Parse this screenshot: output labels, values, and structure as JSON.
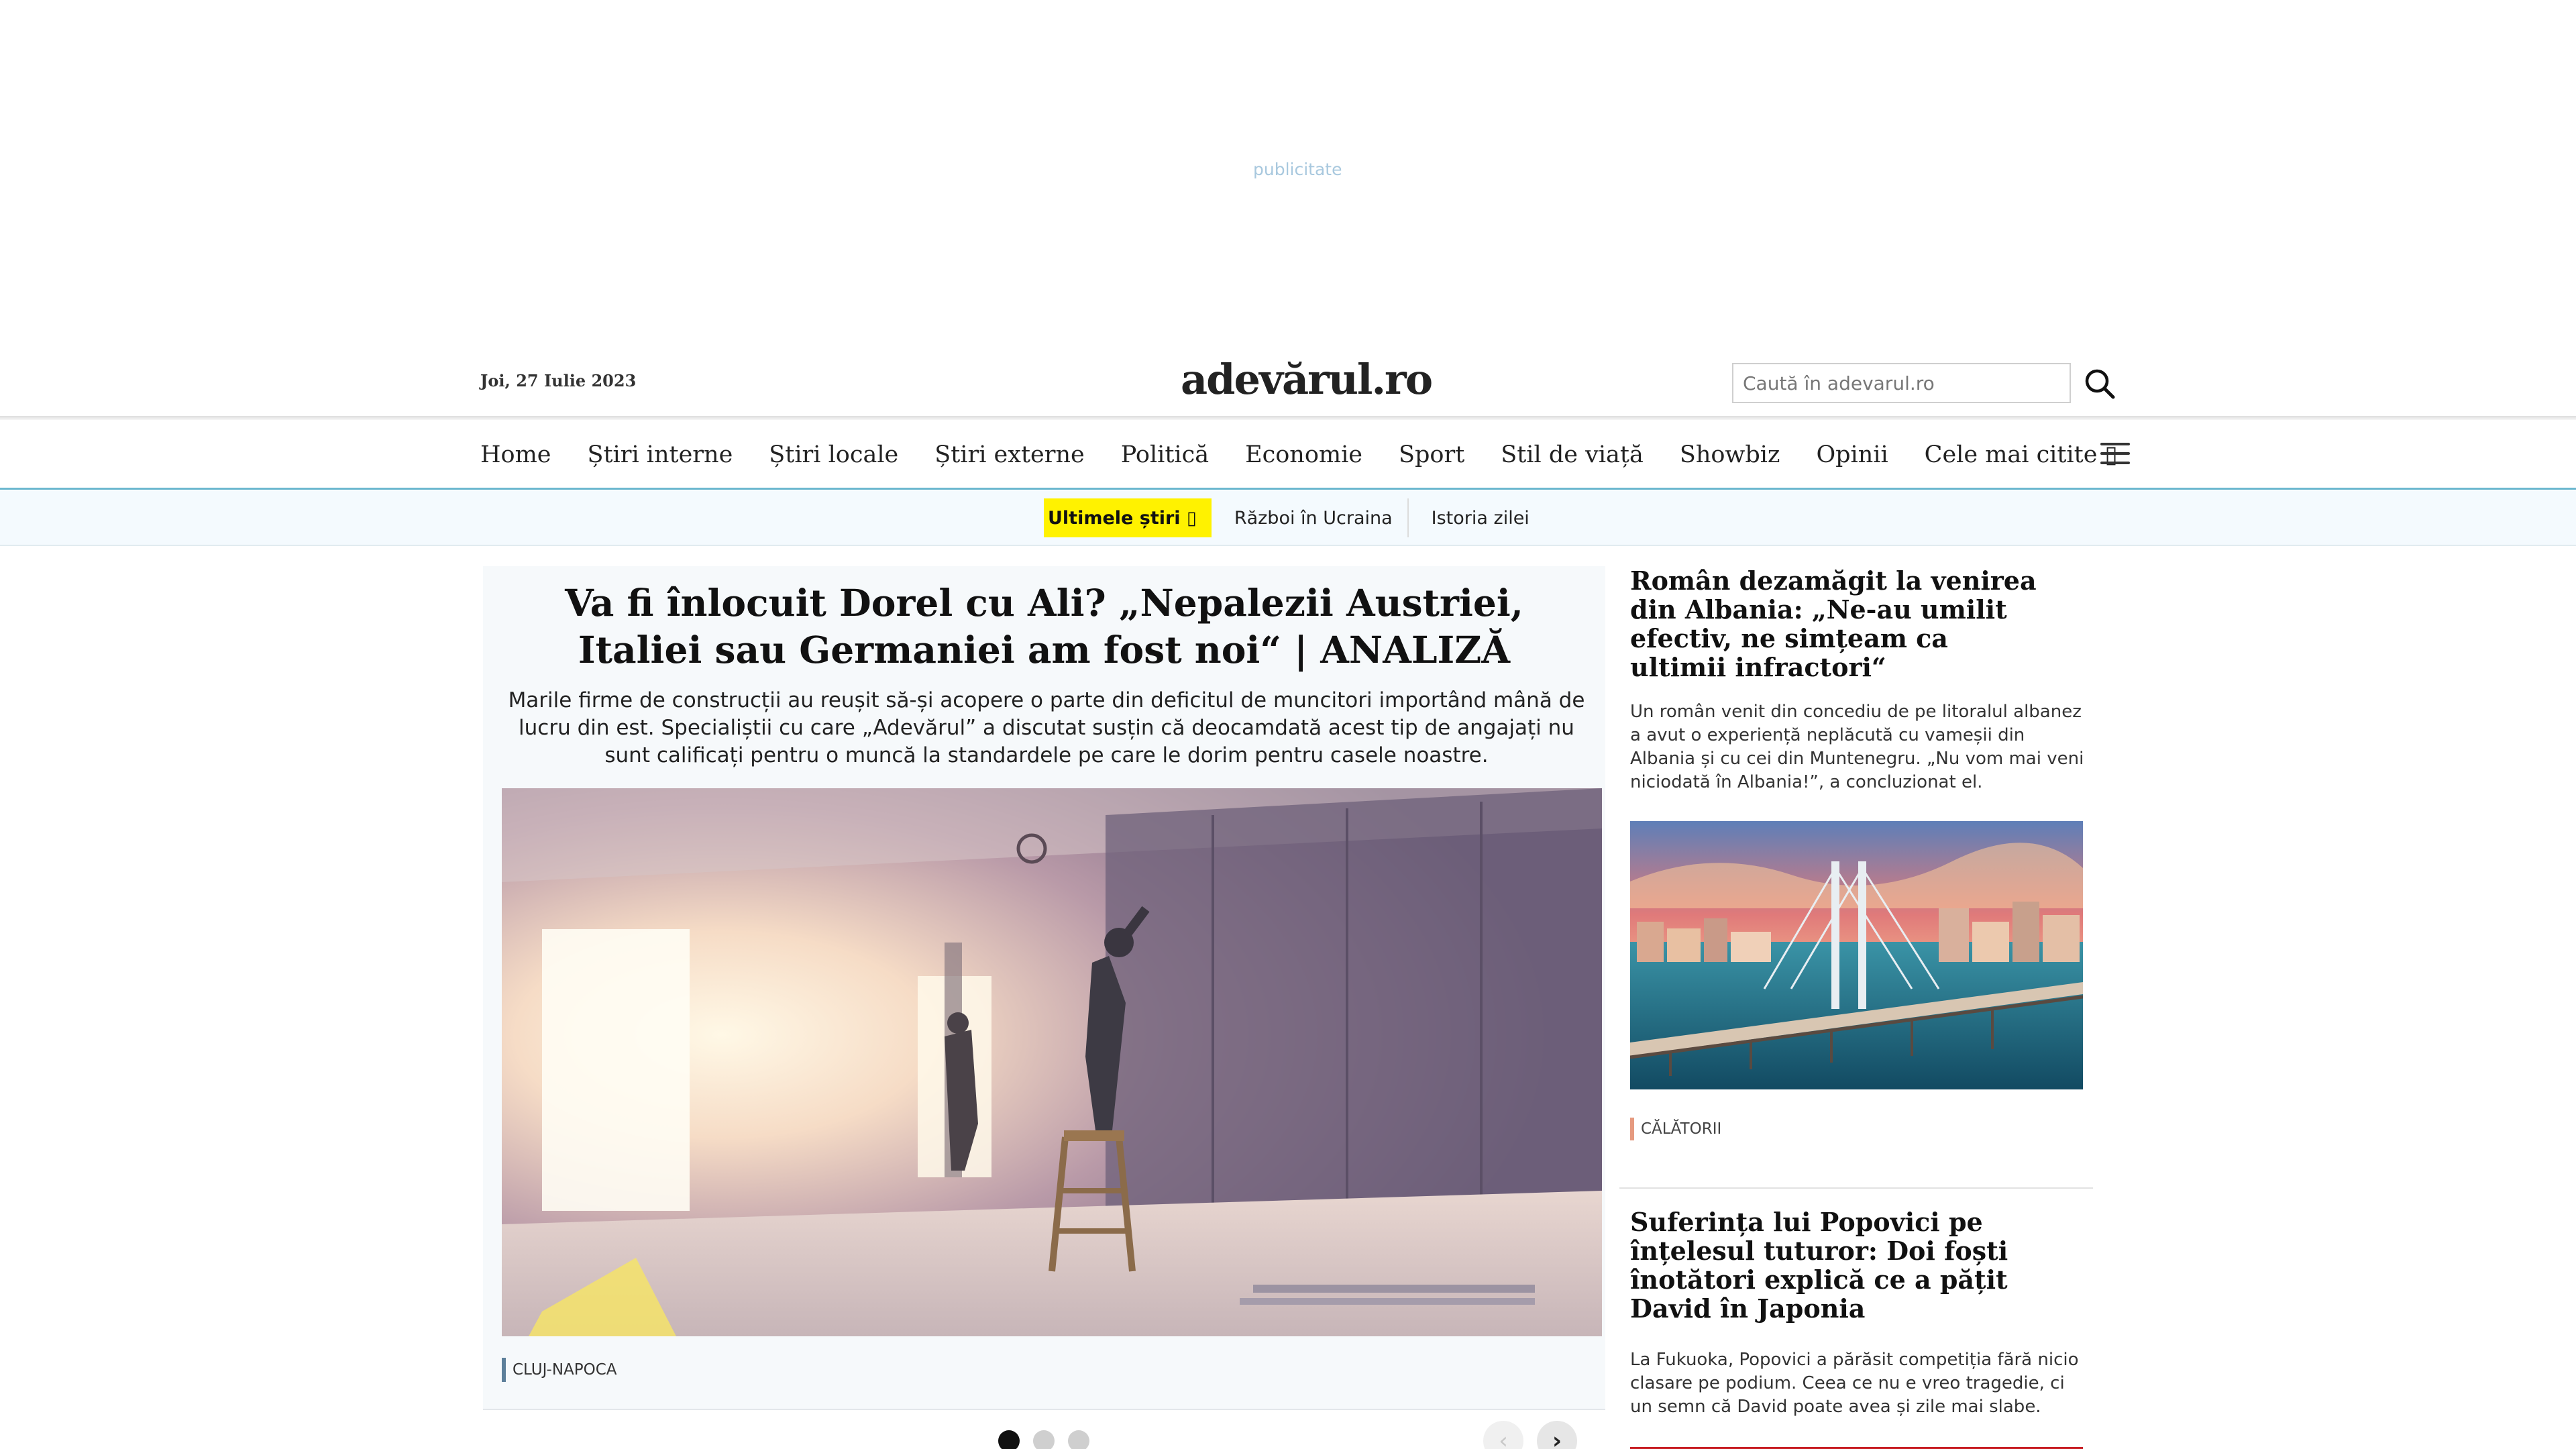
{
  "ad": {
    "label": "publicitate"
  },
  "header": {
    "date": "Joi, 27 Iulie 2023",
    "logo": "adevărul.ro",
    "search_placeholder": "Caută în adevarul.ro"
  },
  "nav": {
    "items": [
      {
        "label": "Home"
      },
      {
        "label": "Știri interne"
      },
      {
        "label": "Știri locale"
      },
      {
        "label": "Știri externe"
      },
      {
        "label": "Politică"
      },
      {
        "label": "Economie"
      },
      {
        "label": "Sport"
      },
      {
        "label": "Stil de viață"
      },
      {
        "label": "Showbiz"
      },
      {
        "label": "Opinii"
      },
      {
        "label": "Cele mai citite ▯"
      }
    ]
  },
  "subnav": {
    "hot": "Ultimele știri ▯",
    "items": [
      {
        "label": "Război în Ucraina"
      },
      {
        "label": "Istoria zilei"
      }
    ]
  },
  "main_article": {
    "title": "Va fi înlocuit Dorel cu Ali? „Nepalezii Austriei, Italiei sau Germaniei am fost noi“ | ANALIZĂ",
    "lead": "Marile firme de construcții au reușit să-și acopere o parte din deficitul de muncitori importând mână de lucru din est. Specialiștii cu care „Adevărul” a discutat susțin că deocamdată acest tip de angajați nu sunt calificați pentru o muncă la standardele pe care le dorim pentru casele noastre.",
    "tag": "CLUJ-NAPOCA"
  },
  "carousel": {
    "dots": 3,
    "active": 0,
    "prev": "‹",
    "next": "›"
  },
  "side_articles": [
    {
      "title": "Român dezamăgit la venirea din Albania: „Ne-au umilit efectiv, ne simțeam ca ultimii infractori“",
      "lead": "Un român venit din concediu de pe litoralul albanez a avut o experiență neplăcută cu vameșii din Albania și cu cei din Muntenegru. „Nu vom mai veni niciodată în Albania!”, a concluzionat el.",
      "tag": "CĂLĂTORII"
    },
    {
      "title": "Suferința lui Popovici pe înțelesul tuturor: Doi foști înotători explică ce a pățit David în Japonia",
      "lead": "La Fukuoka, Popovici a părăsit competiția fără nicio clasare pe podium. Ceea ce nu e vreo tragedie, ci un semn că David poate avea și zile mai slabe."
    }
  ]
}
